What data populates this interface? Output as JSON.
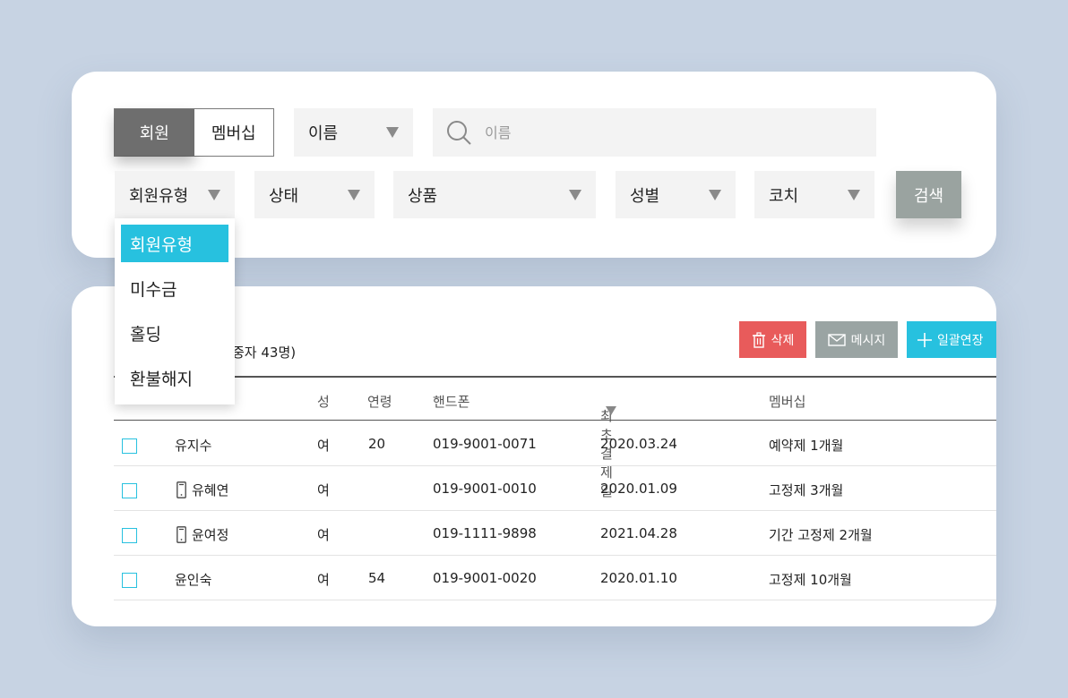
{
  "filter": {
    "toggle": {
      "member": "회원",
      "membership": "멤버십"
    },
    "name_select": "이름",
    "search_placeholder": "이름",
    "member_type": "회원유형",
    "status": "상태",
    "product": "상품",
    "gender": "성별",
    "coach": "코치",
    "search_button": "검색",
    "dropdown_options": [
      "회원유형",
      "미수금",
      "홀딩",
      "환불해지"
    ]
  },
  "list": {
    "count_text": "중자 43명)",
    "actions": {
      "delete": "삭제",
      "message": "메시지",
      "extend": "일괄연장"
    },
    "columns": {
      "gender": "성",
      "age": "연령",
      "phone": "핸드폰",
      "first_payment": "최초결제일",
      "membership": "멤버십"
    },
    "rows": [
      {
        "name": "유지수",
        "app": false,
        "gender": "여",
        "age": "20",
        "phone": "019-9001-0071",
        "first_payment": "2020.03.24",
        "membership": "예약제 1개월"
      },
      {
        "name": "유혜연",
        "app": true,
        "gender": "여",
        "age": "",
        "phone": "019-9001-0010",
        "first_payment": "2020.01.09",
        "membership": "고정제 3개월"
      },
      {
        "name": "윤여정",
        "app": true,
        "gender": "여",
        "age": "",
        "phone": "019-1111-9898",
        "first_payment": "2021.04.28",
        "membership": "기간 고정제 2개월"
      },
      {
        "name": "윤인숙",
        "app": false,
        "gender": "여",
        "age": "54",
        "phone": "019-9001-0020",
        "first_payment": "2020.01.10",
        "membership": "고정제 10개월"
      }
    ]
  },
  "colors": {
    "accent": "#27c1df",
    "delete": "#e85b5b",
    "muted_button": "#9aa4a3",
    "background": "#c7d3e3"
  }
}
